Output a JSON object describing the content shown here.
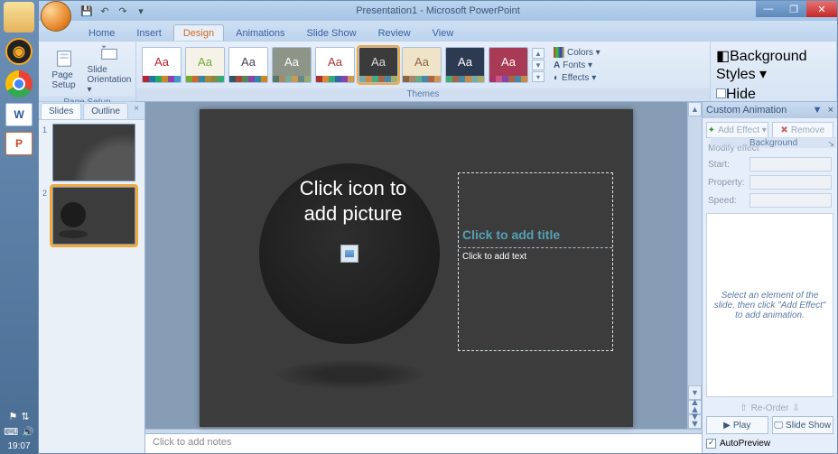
{
  "app": {
    "title": "Presentation1 - Microsoft PowerPoint"
  },
  "qat": {
    "save": "💾",
    "undo": "↶",
    "redo": "↷",
    "more": "▾"
  },
  "win_controls": {
    "min": "—",
    "max": "❐",
    "close": "✕",
    "help": "?"
  },
  "tabs": {
    "home": "Home",
    "insert": "Insert",
    "design": "Design",
    "animations": "Animations",
    "slideshow": "Slide Show",
    "review": "Review",
    "view": "View"
  },
  "ribbon": {
    "page_setup": {
      "page_setup": "Page\nSetup",
      "orientation": "Slide\nOrientation ▾",
      "label": "Page Setup"
    },
    "themes": {
      "label": "Themes",
      "colors": "Colors ▾",
      "fonts": "Fonts ▾",
      "effects": "Effects ▾"
    },
    "background": {
      "styles": "Background Styles ▾",
      "hide": "Hide Background Graphics",
      "label": "Background"
    }
  },
  "slide_panel": {
    "slides_tab": "Slides",
    "outline_tab": "Outline",
    "close": "×",
    "n1": "1",
    "n2": "2"
  },
  "slide": {
    "pic_prompt": "Click icon to add picture",
    "title_prompt": "Click to add title",
    "text_prompt": "Click to add text"
  },
  "notes": {
    "prompt": "Click to add notes"
  },
  "anim": {
    "title": "Custom Animation",
    "add_effect": "Add Effect ▾",
    "remove": "Remove",
    "modify": "Modify effect",
    "start": "Start:",
    "property": "Property:",
    "speed": "Speed:",
    "hint": "Select an element of the slide, then click \"Add Effect\" to add animation.",
    "reorder": "Re-Order",
    "play": "Play",
    "slideshow": "Slide Show",
    "autoprev": "AutoPreview"
  },
  "tray": {
    "time": "19:07"
  }
}
